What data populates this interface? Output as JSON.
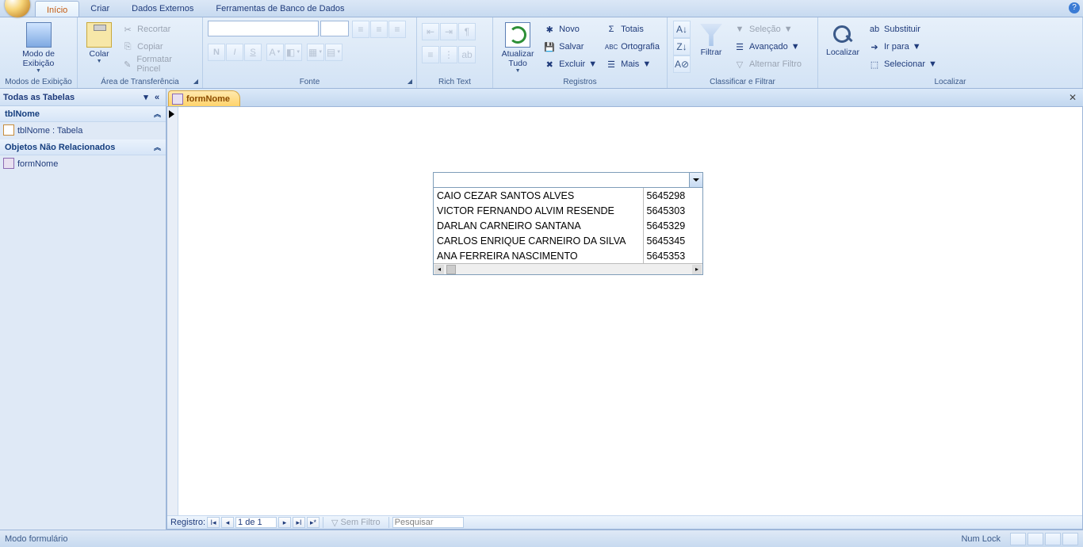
{
  "tabs": {
    "home": "Início",
    "create": "Criar",
    "external": "Dados Externos",
    "dbtools": "Ferramentas de Banco de Dados"
  },
  "ribbon": {
    "views": {
      "label": "Modos de Exibição",
      "view_btn": "Modo de\nExibição"
    },
    "clipboard": {
      "label": "Área de Transferência",
      "paste": "Colar",
      "cut": "Recortar",
      "copy": "Copiar",
      "painter": "Formatar Pincel"
    },
    "font": {
      "label": "Fonte"
    },
    "richtext": {
      "label": "Rich Text"
    },
    "records": {
      "label": "Registros",
      "refresh": "Atualizar\nTudo",
      "new": "Novo",
      "save": "Salvar",
      "delete": "Excluir",
      "totals": "Totais",
      "spelling": "Ortografia",
      "more": "Mais"
    },
    "sortfilter": {
      "label": "Classificar e Filtrar",
      "filter": "Filtrar",
      "selection": "Seleção",
      "advanced": "Avançado",
      "toggle": "Alternar Filtro"
    },
    "find": {
      "label": "Localizar",
      "find_btn": "Localizar",
      "replace": "Substituir",
      "goto": "Ir para",
      "select": "Selecionar"
    }
  },
  "nav": {
    "title": "Todas as Tabelas",
    "group1": "tblNome",
    "item1": "tblNome : Tabela",
    "group2": "Objetos Não Relacionados",
    "item2": "formNome"
  },
  "doc": {
    "tab": "formNome"
  },
  "combo": {
    "rows": [
      {
        "name": "CAIO CEZAR SANTOS ALVES",
        "code": "5645298"
      },
      {
        "name": "VICTOR FERNANDO ALVIM RESENDE",
        "code": "5645303"
      },
      {
        "name": "DARLAN CARNEIRO SANTANA",
        "code": "5645329"
      },
      {
        "name": "CARLOS ENRIQUE CARNEIRO DA SILVA",
        "code": "5645345"
      },
      {
        "name": "ANA FERREIRA NASCIMENTO",
        "code": "5645353"
      }
    ]
  },
  "recnav": {
    "label": "Registro:",
    "pos": "1 de 1",
    "nofilter": "Sem Filtro",
    "search": "Pesquisar"
  },
  "status": {
    "mode": "Modo formulário",
    "numlock": "Num Lock"
  }
}
